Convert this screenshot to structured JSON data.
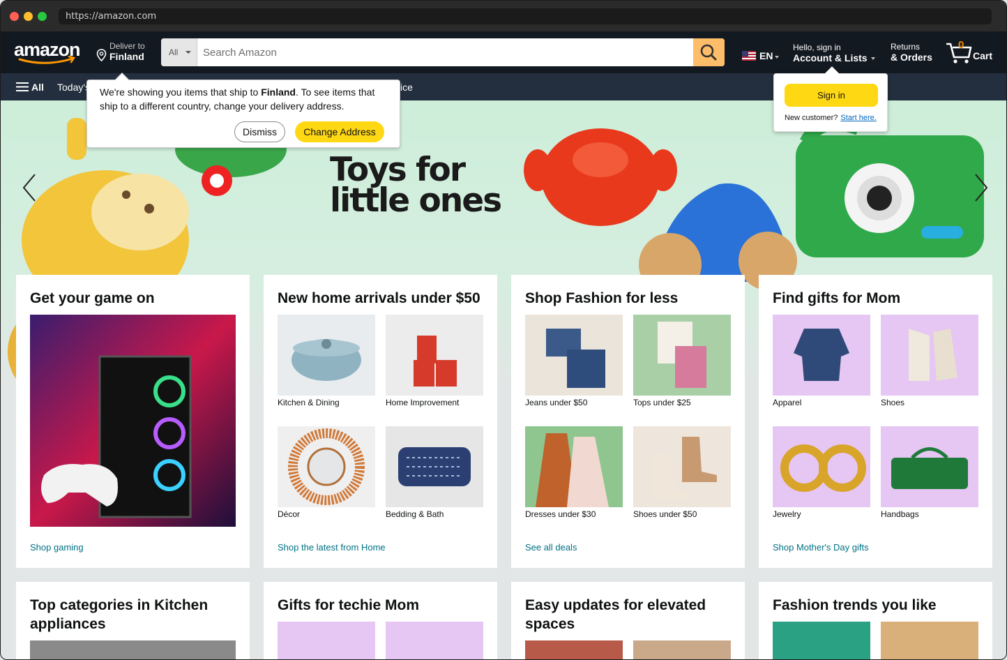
{
  "browser": {
    "url": "https://amazon.com"
  },
  "header": {
    "deliver_small": "Deliver to",
    "deliver_big": "Finland",
    "search_category": "All",
    "search_placeholder": "Search Amazon",
    "language": "EN",
    "account_small": "Hello, sign in",
    "account_big": "Account & Lists",
    "orders_small": "Returns",
    "orders_big": "& Orders",
    "cart_count": "0",
    "cart_label": "Cart"
  },
  "subnav": {
    "all": "All",
    "link1": "Today's",
    "link2": "vice"
  },
  "hero": {
    "line1": "Toys for",
    "line2": "little ones"
  },
  "tooltip": {
    "text_before": "We're showing you items that ship to ",
    "country": "Finland",
    "text_after": ". To see items that ship to a different country, change your delivery address.",
    "dismiss": "Dismiss",
    "change": "Change Address"
  },
  "flyout": {
    "signin": "Sign in",
    "new_customer": "New customer?",
    "start_here": "Start here."
  },
  "cards": [
    {
      "title": "Get your game on",
      "link": "Shop gaming"
    },
    {
      "title": "New home arrivals under $50",
      "link": "Shop the latest from Home",
      "items": [
        "Kitchen & Dining",
        "Home Improvement",
        "Décor",
        "Bedding & Bath"
      ]
    },
    {
      "title": "Shop Fashion for less",
      "link": "See all deals",
      "items": [
        "Jeans under $50",
        "Tops under $25",
        "Dresses under $30",
        "Shoes under $50"
      ]
    },
    {
      "title": "Find gifts for Mom",
      "link": "Shop Mother's Day gifts",
      "items": [
        "Apparel",
        "Shoes",
        "Jewelry",
        "Handbags"
      ]
    }
  ],
  "cards_row2": [
    {
      "title": "Top categories in Kitchen appliances"
    },
    {
      "title": "Gifts for techie Mom"
    },
    {
      "title": "Easy updates for elevated spaces"
    },
    {
      "title": "Fashion trends you like"
    }
  ],
  "colors": {
    "nav": "#131921",
    "subnav": "#232f3e",
    "accent": "#febd69",
    "button": "#ffd814",
    "link": "#007185"
  }
}
